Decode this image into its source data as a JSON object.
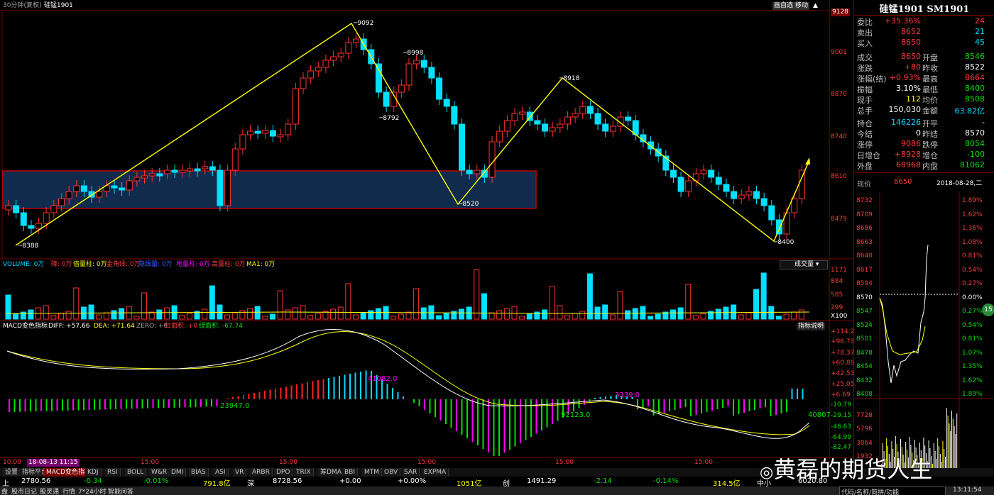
{
  "header": {
    "title": "30分钟(复权)",
    "symbol": "硅锰1901",
    "btn_draw": "画自选",
    "btn_share": "移动"
  },
  "price_axis": [
    "9128",
    "9001",
    "8870",
    "8740",
    "8610",
    "8479"
  ],
  "peak_labels": {
    "p1": "9092",
    "p2": "8998",
    "p3": "8792",
    "p4": "8520",
    "p5": "8918",
    "p6": "8400",
    "p7": "8388"
  },
  "volume_header": {
    "volume": "VOLUME: 0万",
    "down": "降: 0万",
    "multi": "倍量柱: 0万",
    "gold": "金角线: 0万",
    "hidden": "隐线量: 0万",
    "ground": "地量柱: 0万",
    "high": "高量柱: 0万",
    "ma1": "MA1: 0万",
    "dropdown": "成交量"
  },
  "volume_axis": [
    "1171",
    "884",
    "585",
    "299",
    "X100"
  ],
  "macd_header": {
    "name": "MACD变色指标",
    "diff": "DIFF: +57.66",
    "dea": "DEA: +71.64",
    "zero": "ZERO: +0",
    "red": "红面积: +0",
    "green": "绿面积: -67.74",
    "help": "指标说明"
  },
  "macd_axis": [
    "+114.2",
    "+96.73",
    "+78.37",
    "+60.89",
    "+42.53",
    "+25.05",
    "+6.69",
    "-10.79",
    "-29.15",
    "-46.63",
    "-64.99",
    "-82.47"
  ],
  "macd_labels": {
    "l1": "23947.0",
    "l2": "41082.0",
    "l3": "3339.0",
    "l4": "92123.0",
    "l5": "40807"
  },
  "time_axis": [
    "10:00",
    "18-08-13 11:15",
    "15:00",
    "15:00",
    "15:00",
    "15:00",
    "15:00"
  ],
  "quote": {
    "title": "硅锰1901 SM1901",
    "rows": [
      {
        "label": "委比",
        "value": "+35.36%",
        "extra": "24",
        "vcls": "red",
        "ecls": "red"
      },
      {
        "label": "卖出",
        "value": "8652",
        "extra": "21",
        "vcls": "red",
        "ecls": "cyan"
      },
      {
        "label": "买入",
        "value": "8650",
        "extra": "45",
        "vcls": "red",
        "ecls": "cyan"
      },
      {
        "label": "成交",
        "value": "8650",
        "label2": "开盘",
        "extra": "8546",
        "vcls": "red",
        "ecls": "green"
      },
      {
        "label": "涨跌",
        "value": "+80",
        "label2": "昨收",
        "extra": "8522",
        "vcls": "red",
        "ecls": "white"
      },
      {
        "label": "涨幅(结)",
        "value": "+0.93%",
        "label2": "最高",
        "extra": "8664",
        "vcls": "red",
        "ecls": "red"
      },
      {
        "label": "振幅",
        "value": "3.10%",
        "label2": "最低",
        "extra": "8400",
        "vcls": "white",
        "ecls": "green"
      },
      {
        "label": "现手",
        "value": "112",
        "label2": "均价",
        "extra": "8508",
        "vcls": "yellow",
        "ecls": "green"
      },
      {
        "label": "总手",
        "value": "150,030",
        "label2": "金额",
        "extra": "63.82亿",
        "vcls": "white",
        "ecls": "cyan"
      },
      {
        "label": "持仓",
        "value": "146226",
        "label2": "开平",
        "extra": "-",
        "vcls": "cyan",
        "ecls": "white"
      },
      {
        "label": "今结",
        "value": "0",
        "label2": "昨结",
        "extra": "8570",
        "vcls": "white",
        "ecls": "white"
      },
      {
        "label": "涨停",
        "value": "9086",
        "label2": "跌停",
        "extra": "8054",
        "vcls": "red",
        "ecls": "green"
      },
      {
        "label": "日增仓",
        "value": "+8928",
        "label2": "增仓",
        "extra": "-100",
        "vcls": "red",
        "ecls": "green"
      },
      {
        "label": "外盘",
        "value": "68968",
        "label2": "内盘",
        "extra": "81062",
        "vcls": "red",
        "ecls": "green"
      }
    ],
    "price_label": "现价",
    "price_value": "8650",
    "date": "2018-08-28,二"
  },
  "mini_left_axis": [
    "8732",
    "8709",
    "8686",
    "8663",
    "8640",
    "8617",
    "8594",
    "8570",
    "8547",
    "8524",
    "8501",
    "8478",
    "8454",
    "8432",
    "8408",
    "7728",
    "5796",
    "3864",
    "1932"
  ],
  "mini_right_axis": [
    "1.89%",
    "1.62%",
    "1.36%",
    "1.08%",
    "0.81%",
    "0.54%",
    "0.27%",
    "0.00%",
    "0.27%",
    "0.54%",
    "0.81%",
    "1.07%",
    "1.35%",
    "1.62%",
    "1.89%"
  ],
  "mini_badge": "15",
  "tabs": [
    "设置",
    "指标平台",
    "MACD变色指标",
    "KDJ",
    "RSI",
    "BOLL",
    "W&R",
    "DMI",
    "BIAS",
    "ASI",
    "VR",
    "ARBR",
    "DPO",
    "TRIX",
    "筹DMA",
    "BBI",
    "MTM",
    "OBV",
    "SAR",
    "EXPMA"
  ],
  "status": {
    "s1": "上",
    "v1": "2780.56",
    "c1": "-0.34",
    "p1": "-0.01%",
    "a1": "791.8亿",
    "s2": "深",
    "v2": "8728.56",
    "c2": "+0.00",
    "p2": "+0.00%",
    "a2": "1051亿",
    "s3": "创",
    "v3": "1491.29",
    "c3": "-2.14",
    "p3": "-0.14%",
    "a3": "314.5亿",
    "s4": "中小",
    "v4": "6020.80"
  },
  "bottom": {
    "items": [
      "盘",
      "股市日记",
      "股灵通",
      "行情",
      "7*24小时",
      "智能问答"
    ],
    "search": "代码/名称/简拼/功能",
    "time": "13:11:54",
    "watermark": "黄磊的期货人生"
  }
}
